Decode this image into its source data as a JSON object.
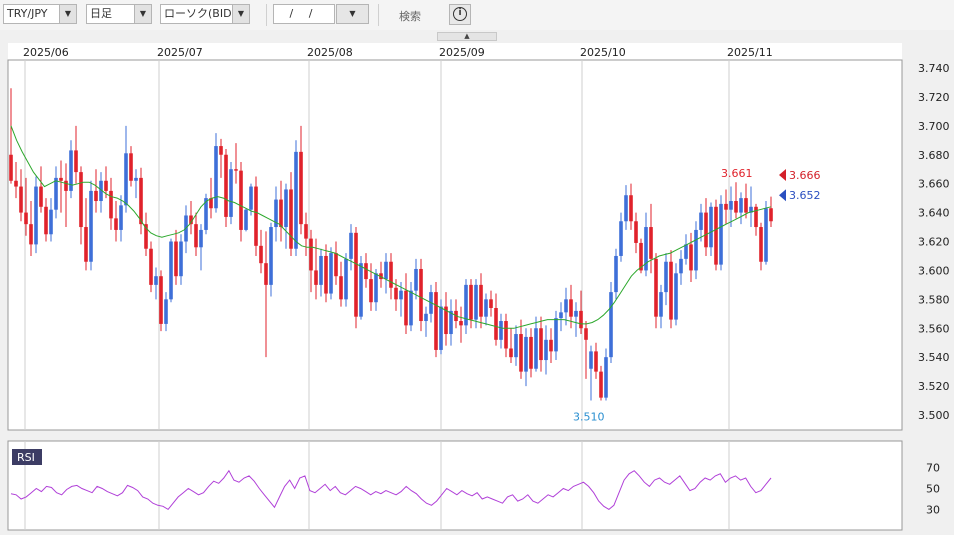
{
  "toolbar": {
    "pair": "TRY/JPY",
    "timeframe": "日足",
    "chart_type": "ローソク(BID)",
    "date_value": "/ /",
    "search_label": "検索",
    "info_label": "i"
  },
  "colors": {
    "up": "#3e6fd8",
    "down": "#e0222b",
    "ma": "#2ca82c",
    "rsi": "#b040d8"
  },
  "chart_data": [
    {
      "type": "candlestick",
      "x_labels": [
        "2025/06",
        "2025/07",
        "2025/08",
        "2025/09",
        "2025/10",
        "2025/11"
      ],
      "y_ticks": [
        "3.740",
        "3.720",
        "3.700",
        "3.680",
        "3.660",
        "3.640",
        "3.620",
        "3.600",
        "3.580",
        "3.560",
        "3.540",
        "3.520",
        "3.500"
      ],
      "ylim": [
        3.495,
        3.742
      ],
      "grid": true,
      "annotations": [
        {
          "text": "3.661",
          "color": "#e0222b"
        },
        {
          "text": "3.510",
          "color": "#2a8fd0"
        }
      ],
      "price_markers": [
        {
          "text": "3.666",
          "color": "#d3212a"
        },
        {
          "text": "3.652",
          "color": "#2a4fc0"
        }
      ],
      "candles_ohlc": [
        [
          3.68,
          3.726,
          3.66,
          3.662
        ],
        [
          3.662,
          3.675,
          3.65,
          3.658
        ],
        [
          3.658,
          3.67,
          3.634,
          3.64
        ],
        [
          3.64,
          3.664,
          3.624,
          3.632
        ],
        [
          3.632,
          3.648,
          3.61,
          3.618
        ],
        [
          3.618,
          3.665,
          3.612,
          3.658
        ],
        [
          3.658,
          3.672,
          3.64,
          3.644
        ],
        [
          3.644,
          3.65,
          3.62,
          3.625
        ],
        [
          3.625,
          3.65,
          3.62,
          3.642
        ],
        [
          3.642,
          3.672,
          3.636,
          3.664
        ],
        [
          3.664,
          3.676,
          3.64,
          3.662
        ],
        [
          3.662,
          3.674,
          3.63,
          3.655
        ],
        [
          3.655,
          3.69,
          3.65,
          3.683
        ],
        [
          3.683,
          3.7,
          3.66,
          3.668
        ],
        [
          3.668,
          3.672,
          3.618,
          3.63
        ],
        [
          3.63,
          3.65,
          3.6,
          3.606
        ],
        [
          3.606,
          3.662,
          3.6,
          3.655
        ],
        [
          3.655,
          3.67,
          3.64,
          3.648
        ],
        [
          3.648,
          3.668,
          3.64,
          3.662
        ],
        [
          3.662,
          3.672,
          3.65,
          3.655
        ],
        [
          3.655,
          3.664,
          3.628,
          3.636
        ],
        [
          3.636,
          3.648,
          3.62,
          3.628
        ],
        [
          3.628,
          3.652,
          3.62,
          3.645
        ],
        [
          3.645,
          3.7,
          3.64,
          3.681
        ],
        [
          3.681,
          3.686,
          3.658,
          3.662
        ],
        [
          3.662,
          3.67,
          3.65,
          3.664
        ],
        [
          3.664,
          3.671,
          3.625,
          3.632
        ],
        [
          3.632,
          3.64,
          3.61,
          3.615
        ],
        [
          3.615,
          3.62,
          3.585,
          3.59
        ],
        [
          3.59,
          3.602,
          3.58,
          3.596
        ],
        [
          3.596,
          3.6,
          3.558,
          3.563
        ],
        [
          3.563,
          3.585,
          3.558,
          3.58
        ],
        [
          3.58,
          3.622,
          3.578,
          3.62
        ],
        [
          3.62,
          3.628,
          3.59,
          3.596
        ],
        [
          3.596,
          3.625,
          3.59,
          3.62
        ],
        [
          3.62,
          3.645,
          3.612,
          3.638
        ],
        [
          3.638,
          3.648,
          3.625,
          3.632
        ],
        [
          3.632,
          3.64,
          3.61,
          3.616
        ],
        [
          3.616,
          3.632,
          3.6,
          3.628
        ],
        [
          3.628,
          3.653,
          3.625,
          3.65
        ],
        [
          3.65,
          3.664,
          3.636,
          3.643
        ],
        [
          3.643,
          3.695,
          3.64,
          3.686
        ],
        [
          3.686,
          3.691,
          3.664,
          3.68
        ],
        [
          3.68,
          3.684,
          3.63,
          3.637
        ],
        [
          3.637,
          3.675,
          3.632,
          3.67
        ],
        [
          3.67,
          3.688,
          3.66,
          3.669
        ],
        [
          3.669,
          3.675,
          3.62,
          3.628
        ],
        [
          3.628,
          3.643,
          3.627,
          3.642
        ],
        [
          3.642,
          3.66,
          3.638,
          3.658
        ],
        [
          3.658,
          3.665,
          3.61,
          3.617
        ],
        [
          3.617,
          3.628,
          3.598,
          3.605
        ],
        [
          3.605,
          3.627,
          3.54,
          3.59
        ],
        [
          3.59,
          3.633,
          3.582,
          3.63
        ],
        [
          3.63,
          3.658,
          3.62,
          3.649
        ],
        [
          3.649,
          3.662,
          3.62,
          3.63
        ],
        [
          3.63,
          3.66,
          3.615,
          3.656
        ],
        [
          3.656,
          3.668,
          3.61,
          3.615
        ],
        [
          3.615,
          3.69,
          3.61,
          3.682
        ],
        [
          3.682,
          3.7,
          3.625,
          3.632
        ],
        [
          3.632,
          3.64,
          3.61,
          3.622
        ],
        [
          3.622,
          3.628,
          3.585,
          3.6
        ],
        [
          3.6,
          3.622,
          3.58,
          3.59
        ],
        [
          3.59,
          3.615,
          3.582,
          3.61
        ],
        [
          3.61,
          3.618,
          3.578,
          3.584
        ],
        [
          3.584,
          3.616,
          3.58,
          3.612
        ],
        [
          3.612,
          3.62,
          3.59,
          3.596
        ],
        [
          3.596,
          3.606,
          3.575,
          3.58
        ],
        [
          3.58,
          3.612,
          3.575,
          3.608
        ],
        [
          3.608,
          3.632,
          3.6,
          3.626
        ],
        [
          3.626,
          3.63,
          3.56,
          3.568
        ],
        [
          3.568,
          3.61,
          3.566,
          3.605
        ],
        [
          3.605,
          3.612,
          3.588,
          3.594
        ],
        [
          3.594,
          3.605,
          3.572,
          3.578
        ],
        [
          3.578,
          3.601,
          3.572,
          3.598
        ],
        [
          3.598,
          3.606,
          3.588,
          3.594
        ],
        [
          3.594,
          3.612,
          3.584,
          3.606
        ],
        [
          3.606,
          3.612,
          3.58,
          3.588
        ],
        [
          3.588,
          3.594,
          3.572,
          3.58
        ],
        [
          3.58,
          3.592,
          3.568,
          3.586
        ],
        [
          3.586,
          3.598,
          3.556,
          3.562
        ],
        [
          3.562,
          3.592,
          3.558,
          3.586
        ],
        [
          3.586,
          3.608,
          3.58,
          3.601
        ],
        [
          3.601,
          3.608,
          3.558,
          3.565
        ],
        [
          3.565,
          3.575,
          3.554,
          3.57
        ],
        [
          3.57,
          3.59,
          3.564,
          3.585
        ],
        [
          3.585,
          3.592,
          3.54,
          3.545
        ],
        [
          3.545,
          3.58,
          3.542,
          3.575
        ],
        [
          3.575,
          3.585,
          3.548,
          3.556
        ],
        [
          3.556,
          3.58,
          3.548,
          3.572
        ],
        [
          3.572,
          3.58,
          3.56,
          3.565
        ],
        [
          3.565,
          3.575,
          3.55,
          3.562
        ],
        [
          3.562,
          3.594,
          3.556,
          3.59
        ],
        [
          3.59,
          3.594,
          3.56,
          3.566
        ],
        [
          3.566,
          3.594,
          3.56,
          3.59
        ],
        [
          3.59,
          3.598,
          3.56,
          3.568
        ],
        [
          3.568,
          3.584,
          3.562,
          3.58
        ],
        [
          3.58,
          3.586,
          3.568,
          3.574
        ],
        [
          3.574,
          3.584,
          3.548,
          3.552
        ],
        [
          3.552,
          3.57,
          3.546,
          3.565
        ],
        [
          3.565,
          3.57,
          3.54,
          3.546
        ],
        [
          3.546,
          3.56,
          3.536,
          3.54
        ],
        [
          3.54,
          3.562,
          3.534,
          3.556
        ],
        [
          3.556,
          3.566,
          3.525,
          3.53
        ],
        [
          3.53,
          3.56,
          3.52,
          3.554
        ],
        [
          3.554,
          3.56,
          3.526,
          3.532
        ],
        [
          3.532,
          3.568,
          3.53,
          3.56
        ],
        [
          3.56,
          3.568,
          3.53,
          3.538
        ],
        [
          3.538,
          3.562,
          3.528,
          3.552
        ],
        [
          3.552,
          3.56,
          3.536,
          3.544
        ],
        [
          3.544,
          3.572,
          3.538,
          3.567
        ],
        [
          3.567,
          3.578,
          3.558,
          3.571
        ],
        [
          3.571,
          3.588,
          3.562,
          3.58
        ],
        [
          3.58,
          3.59,
          3.56,
          3.568
        ],
        [
          3.568,
          3.578,
          3.554,
          3.572
        ],
        [
          3.572,
          3.586,
          3.556,
          3.56
        ],
        [
          3.56,
          3.565,
          3.525,
          3.552
        ],
        [
          3.532,
          3.548,
          3.51,
          3.544
        ],
        [
          3.544,
          3.55,
          3.525,
          3.53
        ],
        [
          3.53,
          3.534,
          3.51,
          3.512
        ],
        [
          3.512,
          3.546,
          3.51,
          3.54
        ],
        [
          3.54,
          3.592,
          3.536,
          3.585
        ],
        [
          3.585,
          3.615,
          3.58,
          3.61
        ],
        [
          3.61,
          3.64,
          3.606,
          3.634
        ],
        [
          3.634,
          3.659,
          3.628,
          3.652
        ],
        [
          3.652,
          3.66,
          3.628,
          3.634
        ],
        [
          3.634,
          3.64,
          3.612,
          3.619
        ],
        [
          3.619,
          3.622,
          3.598,
          3.6
        ],
        [
          3.6,
          3.64,
          3.596,
          3.63
        ],
        [
          3.63,
          3.646,
          3.598,
          3.608
        ],
        [
          3.608,
          3.612,
          3.56,
          3.568
        ],
        [
          3.568,
          3.59,
          3.56,
          3.585
        ],
        [
          3.585,
          3.612,
          3.576,
          3.606
        ],
        [
          3.606,
          3.614,
          3.56,
          3.566
        ],
        [
          3.566,
          3.605,
          3.562,
          3.598
        ],
        [
          3.598,
          3.614,
          3.59,
          3.608
        ],
        [
          3.608,
          3.625,
          3.604,
          3.618
        ],
        [
          3.618,
          3.626,
          3.592,
          3.6
        ],
        [
          3.6,
          3.634,
          3.594,
          3.628
        ],
        [
          3.628,
          3.646,
          3.62,
          3.64
        ],
        [
          3.64,
          3.65,
          3.61,
          3.616
        ],
        [
          3.616,
          3.647,
          3.61,
          3.644
        ],
        [
          3.644,
          3.649,
          3.6,
          3.604
        ],
        [
          3.604,
          3.652,
          3.6,
          3.646
        ],
        [
          3.646,
          3.656,
          3.632,
          3.642
        ],
        [
          3.642,
          3.658,
          3.63,
          3.648
        ],
        [
          3.648,
          3.661,
          3.636,
          3.64
        ],
        [
          3.64,
          3.654,
          3.632,
          3.65
        ],
        [
          3.65,
          3.66,
          3.636,
          3.64
        ],
        [
          3.64,
          3.658,
          3.63,
          3.644
        ],
        [
          3.644,
          3.646,
          3.624,
          3.63
        ],
        [
          3.63,
          3.633,
          3.6,
          3.606
        ],
        [
          3.606,
          3.648,
          3.604,
          3.643
        ],
        [
          3.643,
          3.651,
          3.63,
          3.634
        ]
      ],
      "moving_average": [
        3.7,
        3.69,
        3.682,
        3.675,
        3.668,
        3.663,
        3.658,
        3.66,
        3.662,
        3.661,
        3.66,
        3.659,
        3.66,
        3.661,
        3.661,
        3.659,
        3.656,
        3.653,
        3.651,
        3.65,
        3.648,
        3.645,
        3.641,
        3.636,
        3.63,
        3.626,
        3.624,
        3.623,
        3.624,
        3.625,
        3.626,
        3.628,
        3.632,
        3.638,
        3.644,
        3.648,
        3.65,
        3.651,
        3.65,
        3.648,
        3.647,
        3.645,
        3.643,
        3.641,
        3.64,
        3.638,
        3.636,
        3.634,
        3.632,
        3.628,
        3.624,
        3.62,
        3.617,
        3.616,
        3.616,
        3.615,
        3.614,
        3.613,
        3.612,
        3.61,
        3.608,
        3.606,
        3.604,
        3.602,
        3.6,
        3.598,
        3.596,
        3.594,
        3.592,
        3.59,
        3.588,
        3.586,
        3.584,
        3.582,
        3.58,
        3.578,
        3.576,
        3.574,
        3.572,
        3.57,
        3.568,
        3.567,
        3.566,
        3.565,
        3.564,
        3.563,
        3.562,
        3.561,
        3.56,
        3.56,
        3.56,
        3.561,
        3.562,
        3.563,
        3.564,
        3.565,
        3.566,
        3.566,
        3.566,
        3.566,
        3.565,
        3.564,
        3.563,
        3.563,
        3.564,
        3.566,
        3.569,
        3.573,
        3.578,
        3.584,
        3.59,
        3.596,
        3.6,
        3.603,
        3.606,
        3.608,
        3.61,
        3.611,
        3.612,
        3.614,
        3.616,
        3.618,
        3.62,
        3.622,
        3.624,
        3.626,
        3.628,
        3.63,
        3.632,
        3.634,
        3.636,
        3.638,
        3.64,
        3.641,
        3.642,
        3.643,
        3.644
      ],
      "candles_align": "right"
    },
    {
      "type": "line",
      "legend": "RSI",
      "y_ticks": [
        "70",
        "50",
        "30"
      ],
      "ylim": [
        18,
        82
      ],
      "values": [
        45,
        44,
        40,
        42,
        46,
        50,
        47,
        52,
        51,
        46,
        44,
        49,
        52,
        53,
        50,
        48,
        46,
        52,
        50,
        47,
        45,
        43,
        46,
        53,
        51,
        48,
        42,
        40,
        36,
        34,
        33,
        30,
        36,
        42,
        46,
        50,
        47,
        44,
        46,
        52,
        57,
        55,
        60,
        67,
        58,
        56,
        60,
        62,
        57,
        50,
        44,
        38,
        32,
        42,
        52,
        58,
        50,
        60,
        62,
        48,
        46,
        50,
        54,
        48,
        52,
        46,
        44,
        48,
        52,
        50,
        47,
        44,
        47,
        45,
        48,
        46,
        44,
        47,
        52,
        48,
        45,
        40,
        36,
        34,
        38,
        44,
        50,
        47,
        44,
        48,
        45,
        43,
        46,
        40,
        42,
        40,
        38,
        36,
        42,
        44,
        38,
        40,
        44,
        38,
        36,
        40,
        44,
        42,
        46,
        50,
        48,
        52,
        54,
        56,
        52,
        46,
        38,
        33,
        30,
        34,
        46,
        58,
        64,
        67,
        62,
        56,
        52,
        58,
        60,
        56,
        54,
        58,
        62,
        55,
        48,
        50,
        56,
        60,
        58,
        62,
        64,
        56,
        60,
        62,
        58,
        60,
        52,
        46,
        48,
        54,
        60
      ]
    }
  ]
}
